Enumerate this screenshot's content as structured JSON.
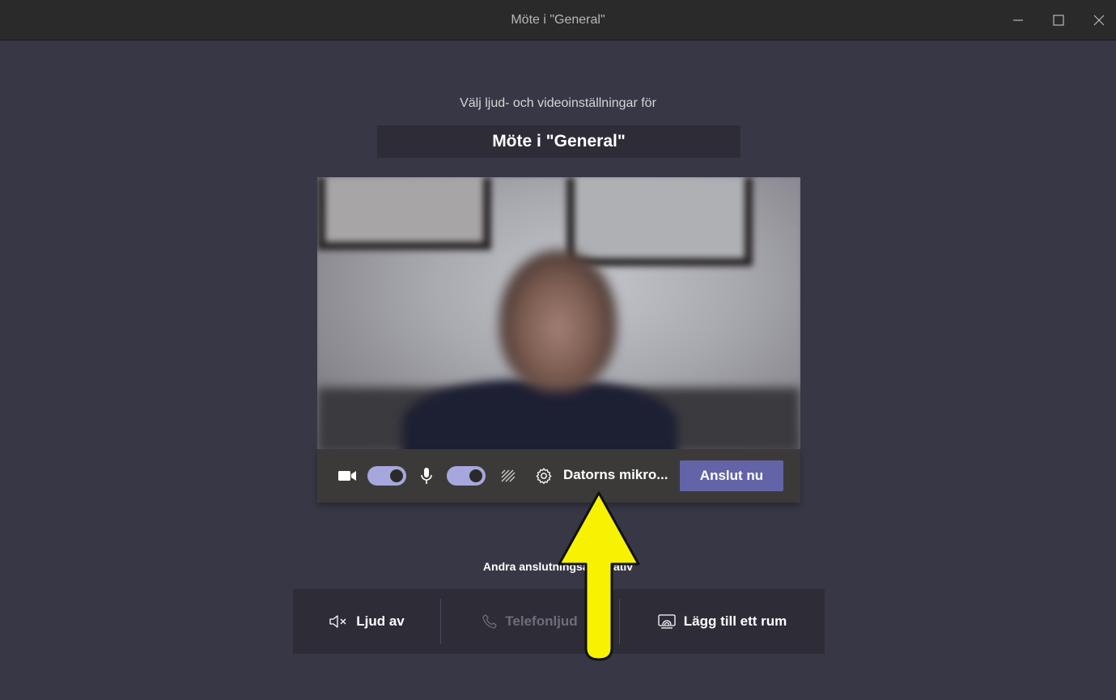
{
  "window": {
    "title": "Möte i \"General\""
  },
  "setup": {
    "subtitle": "Välj ljud- och videoinställningar för",
    "meeting_name": "Möte i \"General\""
  },
  "controls": {
    "camera_on": true,
    "mic_on": true,
    "device_label": "Datorns mikro...",
    "join_label": "Anslut nu"
  },
  "other_options": {
    "heading": "Andra anslutningsalternativ",
    "items": [
      {
        "label": "Ljud av",
        "icon": "speaker-muted-icon",
        "enabled": true
      },
      {
        "label": "Telefonljud",
        "icon": "phone-icon",
        "enabled": false
      },
      {
        "label": "Lägg till ett rum",
        "icon": "room-cast-icon",
        "enabled": true
      }
    ]
  },
  "colors": {
    "background": "#383746",
    "accent": "#6264a7",
    "toggle": "#a6a7dc",
    "annotation_arrow": "#f7f200"
  }
}
